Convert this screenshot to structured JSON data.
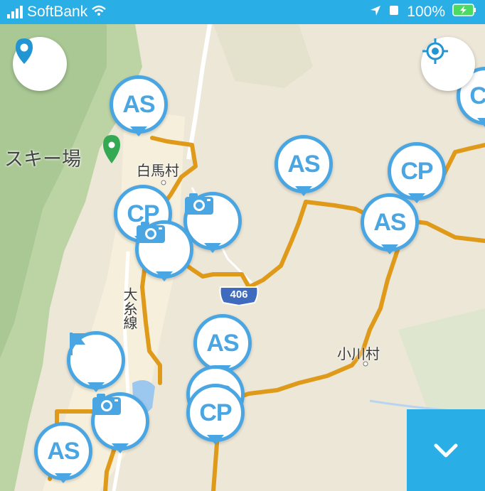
{
  "status_bar": {
    "carrier": "SoftBank",
    "battery": "100%"
  },
  "map": {
    "labels": {
      "ski": "スキー場",
      "hakuba": "白馬村",
      "otari": "小川村",
      "oito": "大糸線",
      "route": "406"
    }
  },
  "markers": {
    "as": "AS",
    "cp": "CP"
  },
  "colors": {
    "status_bar": "#29aee6",
    "marker": "#4aa6e2",
    "route_line": "#e09a1a"
  },
  "icons": [
    "location-pin-icon",
    "locate-crosshair-icon",
    "flag-icon",
    "camera-icon",
    "chevron-down-icon",
    "poi-pin-icon"
  ]
}
